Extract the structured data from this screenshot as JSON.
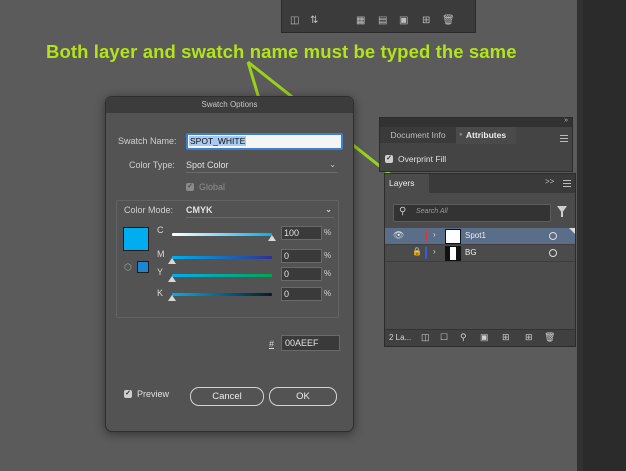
{
  "annotation": {
    "text": "Both layer and swatch name must be typed the same",
    "color": "#b3e31b"
  },
  "top_panel": {
    "icons": [
      "library-icon",
      "links-icon",
      "grid-icon",
      "panel-icon",
      "folder-icon",
      "new-icon",
      "trash-icon"
    ]
  },
  "swatch_dialog": {
    "title": "Swatch Options",
    "swatch_name_label": "Swatch Name:",
    "swatch_name_value": "SPOT_WHITE",
    "color_type_label": "Color Type:",
    "color_type_value": "Spot Color",
    "global_label": "Global",
    "color_mode_label": "Color Mode:",
    "color_mode_value": "CMYK",
    "channels": [
      {
        "label": "C",
        "value": "100",
        "unit": "%",
        "level": 1.0,
        "gradient": "linear-gradient(90deg,#ffffff,#00aeef)"
      },
      {
        "label": "M",
        "value": "0",
        "unit": "%",
        "level": 0.0,
        "gradient": "linear-gradient(90deg,#00aeef,#2e3192)"
      },
      {
        "label": "Y",
        "value": "0",
        "unit": "%",
        "level": 0.0,
        "gradient": "linear-gradient(90deg,#00aeef,#00a651)"
      },
      {
        "label": "K",
        "value": "0",
        "unit": "%",
        "level": 0.0,
        "gradient": "linear-gradient(90deg,#00aeef,#0a1a2a)"
      }
    ],
    "swatch_color": "#00AEEF",
    "hex_hash": "#",
    "hex_value": "00AEEF",
    "preview_label": "Preview",
    "cancel_label": "Cancel",
    "ok_label": "OK"
  },
  "attributes_panel": {
    "tabs": [
      "Document Info",
      "Attributes"
    ],
    "active_tab": "Attributes",
    "overprint_fill_label": "Overprint Fill"
  },
  "layers_panel": {
    "tab_label": "Layers",
    "search_placeholder": "Search All",
    "layers": [
      {
        "name": "Spot1",
        "color": "#d63b3b",
        "selected": true
      },
      {
        "name": "BG",
        "color": "#3b5bd6",
        "selected": false,
        "locked": true
      }
    ],
    "footer_count": "2 La..."
  }
}
